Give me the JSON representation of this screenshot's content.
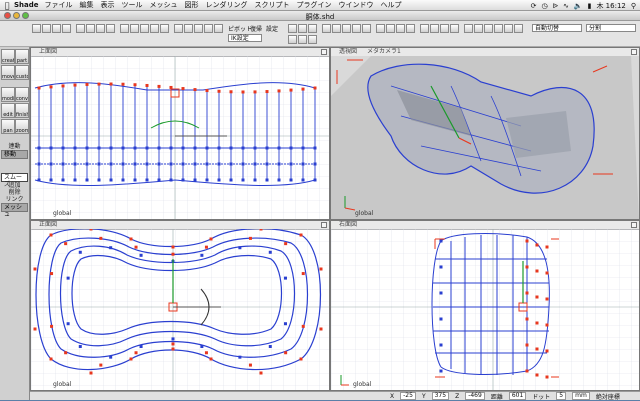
{
  "menubar": {
    "apple": "",
    "app": "Shade",
    "items": [
      "ファイル",
      "編集",
      "表示",
      "ツール",
      "メッシュ",
      "図形",
      "レンダリング",
      "スクリプト",
      "プラグイン",
      "ウインドウ",
      "ヘルプ"
    ],
    "clock": "木 16:12"
  },
  "window": {
    "title": "胴体.shd"
  },
  "toolbar": {
    "pivot_label": "ピボット",
    "restore_label": "復帰",
    "settings_label": "設定",
    "coord_label": "IK設定",
    "auto_label": "自動切替",
    "split_label": "分割"
  },
  "palette": {
    "tools": [
      "create",
      "part",
      "move",
      "custom",
      "modify",
      "convert",
      "edit",
      "finish",
      "pan",
      "zoom"
    ],
    "link_header": "連動",
    "link_item": "移動",
    "smooth_header": "スムーズ",
    "smooth_items": [
      "追加",
      "削除",
      "リンク"
    ],
    "mesh_header": "メッシュ"
  },
  "viewports": {
    "top": {
      "title": "上面図",
      "global": "global"
    },
    "persp": {
      "title": "透視図",
      "camera": "メタカメラ1",
      "global": "global"
    },
    "front": {
      "title": "正面図",
      "global": "global"
    },
    "side": {
      "title": "右面図",
      "global": "global"
    }
  },
  "status": {
    "x_label": "X",
    "x_value": "-25",
    "y_label": "Y",
    "y_value": "375",
    "z_label": "Z",
    "z_value": "-469",
    "dist_label": "距離",
    "dist_value": "601",
    "dot_label": "ドット",
    "dot_value": "5",
    "unit": "mm",
    "abs_label": "絶対座標"
  },
  "colors": {
    "mesh_blue": "#2a3fd0",
    "vertex_red": "#e8371e",
    "grid": "#d6dbe8",
    "axis_green": "#1a9a2a"
  }
}
